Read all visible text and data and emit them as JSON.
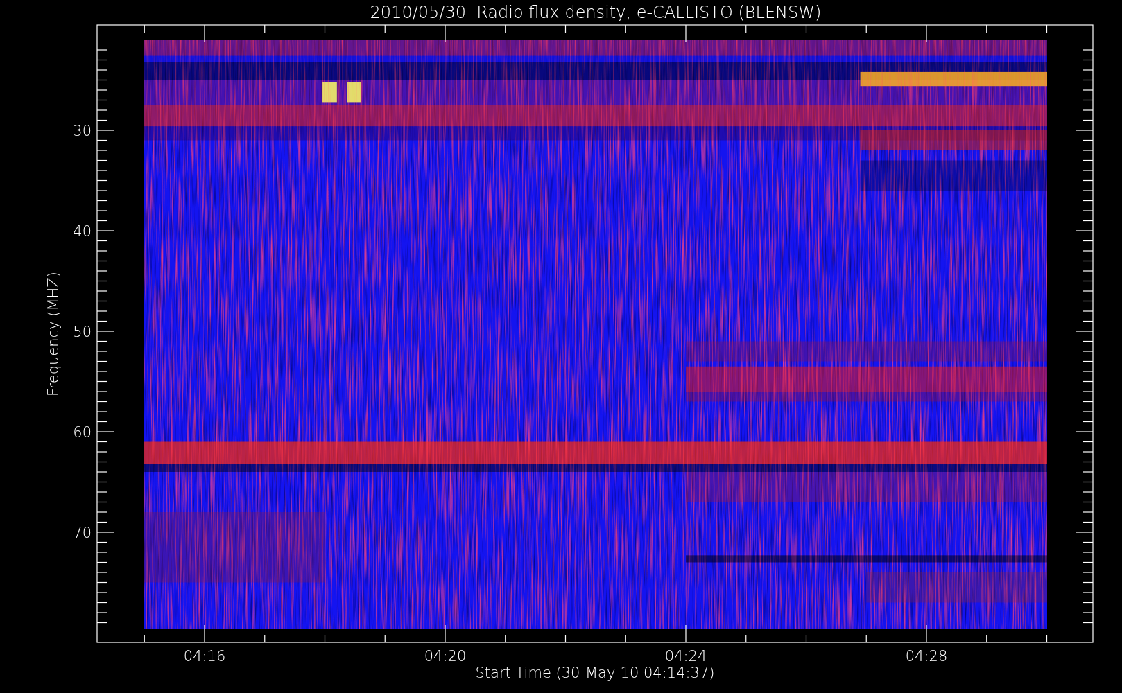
{
  "title": "2010/05/30  Radio flux density, e-CALLISTO (BLENSW)",
  "y_axis": {
    "label": "Frequency (MHZ)",
    "ticks": [
      "30",
      "40",
      "50",
      "60",
      "70"
    ]
  },
  "x_axis": {
    "label": "Start Time (30-May-10 04:14:37)",
    "ticks": [
      "04:16",
      "04:20",
      "04:24",
      "04:28"
    ]
  }
}
